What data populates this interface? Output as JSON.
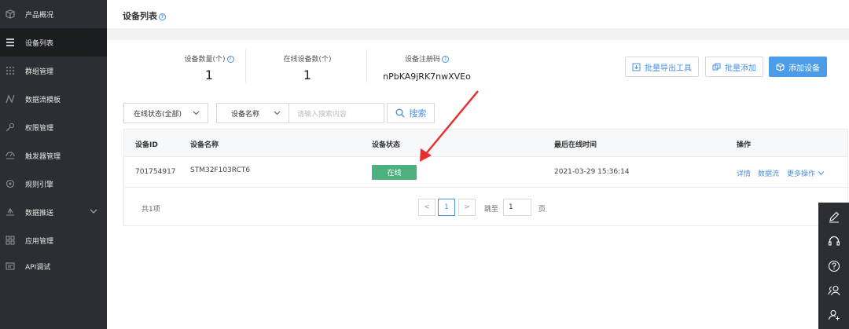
{
  "sidebar": {
    "items": [
      {
        "label": "产品概况",
        "icon": "box-icon"
      },
      {
        "label": "设备列表",
        "icon": "list-icon"
      },
      {
        "label": "群组管理",
        "icon": "grid-dots-icon"
      },
      {
        "label": "数据流模板",
        "icon": "dataflow-icon"
      },
      {
        "label": "权限管理",
        "icon": "key-icon"
      },
      {
        "label": "触发器管理",
        "icon": "trigger-icon"
      },
      {
        "label": "规则引擎",
        "icon": "rule-engine-icon"
      },
      {
        "label": "数据推送",
        "icon": "push-icon"
      },
      {
        "label": "应用管理",
        "icon": "apps-icon"
      },
      {
        "label": "API调试",
        "icon": "api-icon"
      }
    ],
    "active_index": 1
  },
  "header": {
    "title": "设备列表",
    "help": "?"
  },
  "stats": {
    "device_count_label": "设备数量(个)",
    "device_count_value": "1",
    "online_count_label": "在线设备数(个)",
    "online_count_value": "1",
    "reg_code_label": "设备注册码",
    "reg_code_value": "nPbKA9jRK7nwXVEo"
  },
  "actions": {
    "export_tool": "批量导出工具",
    "batch_add": "批量添加",
    "add_device": "添加设备"
  },
  "filters": {
    "status_select": "在线状态(全部)",
    "field_select": "设备名称",
    "search_placeholder": "请输入搜索内容",
    "search_button": "搜索"
  },
  "table": {
    "columns": [
      "设备ID",
      "设备名称",
      "设备状态",
      "最后在线时间",
      "操作"
    ],
    "rows": [
      {
        "device_id": "701754917",
        "device_name": "STM32F103RCT6",
        "status": "在线",
        "last_online": "2021-03-29 15:36:14",
        "ops": [
          "详情",
          "数据流",
          "更多操作"
        ]
      }
    ]
  },
  "pagination": {
    "total": "共1项",
    "prev": "<",
    "current_page": "1",
    "next": ">",
    "jump_label": "跳至",
    "jump_value": "1",
    "page_unit": "页"
  },
  "float_tools": [
    "edit-icon",
    "headset-icon",
    "help-circle-icon",
    "users-icon",
    "add-user-icon"
  ],
  "colors": {
    "sidebar_bg": "#2c2e33",
    "accent": "#4a90e2",
    "primary_button": "#4a9be8",
    "online_badge": "#4cb07f",
    "annotation_arrow": "#e8312f"
  }
}
